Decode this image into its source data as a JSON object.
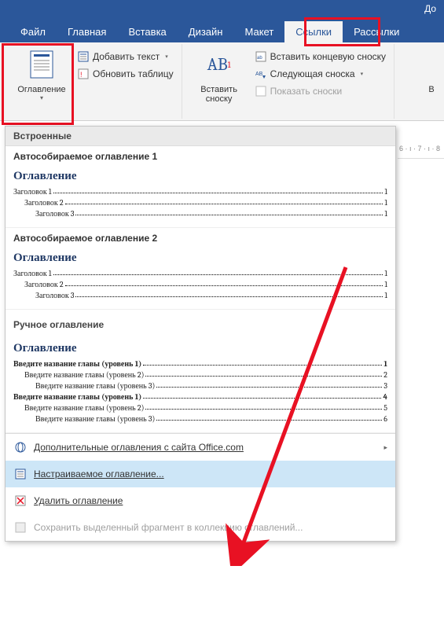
{
  "titlebar": {
    "doc": "До"
  },
  "tabs": {
    "file": "Файл",
    "home": "Главная",
    "insert": "Вставка",
    "design": "Дизайн",
    "layout": "Макет",
    "references": "Ссылки",
    "mailings": "Рассылки"
  },
  "ribbon": {
    "toc": {
      "label": "Оглавление"
    },
    "addText": "Добавить текст",
    "updateTable": "Обновить таблицу",
    "insertFootnote": {
      "big": "AB",
      "sup": "1",
      "label": "Вставить\nсноску"
    },
    "insertEndnote": "Вставить концевую сноску",
    "nextFootnote": "Следующая сноска",
    "showNotes": "Показать сноски",
    "rightB": "В"
  },
  "ruler": {
    "text": "6 · ı · 7 · ı · 8"
  },
  "dropdown": {
    "sectionBuiltIn": "Встроенные",
    "auto1": {
      "title": "Автособираемое оглавление 1",
      "heading": "Оглавление",
      "entries": [
        {
          "text": "Заголовок 1",
          "page": "1",
          "lvl": 1
        },
        {
          "text": "Заголовок 2",
          "page": "1",
          "lvl": 2
        },
        {
          "text": "Заголовок 3",
          "page": "1",
          "lvl": 3
        }
      ]
    },
    "auto2": {
      "title": "Автособираемое оглавление 2",
      "heading": "Оглавление",
      "entries": [
        {
          "text": "Заголовок 1",
          "page": "1",
          "lvl": 1
        },
        {
          "text": "Заголовок 2",
          "page": "1",
          "lvl": 2
        },
        {
          "text": "Заголовок 3",
          "page": "1",
          "lvl": 3
        }
      ]
    },
    "sectionManual": "Ручное оглавление",
    "manual": {
      "heading": "Оглавление",
      "entries": [
        {
          "text": "Введите название главы (уровень 1)",
          "page": "1",
          "lvl": 1,
          "bold": true
        },
        {
          "text": "Введите название главы (уровень 2)",
          "page": "2",
          "lvl": 2
        },
        {
          "text": "Введите название главы (уровень 3)",
          "page": "3",
          "lvl": 3
        },
        {
          "text": "Введите название главы (уровень 1)",
          "page": "4",
          "lvl": 1,
          "bold": true
        },
        {
          "text": "Введите название главы (уровень 2)",
          "page": "5",
          "lvl": 2
        },
        {
          "text": "Введите название главы (уровень 3)",
          "page": "6",
          "lvl": 3
        }
      ]
    },
    "moreOnline": "Дополнительные оглавления с сайта Office.com",
    "custom": "Настраиваемое оглавление...",
    "remove": "Удалить оглавление",
    "save": "Сохранить выделенный фрагмент в коллекцию оглавлений..."
  }
}
